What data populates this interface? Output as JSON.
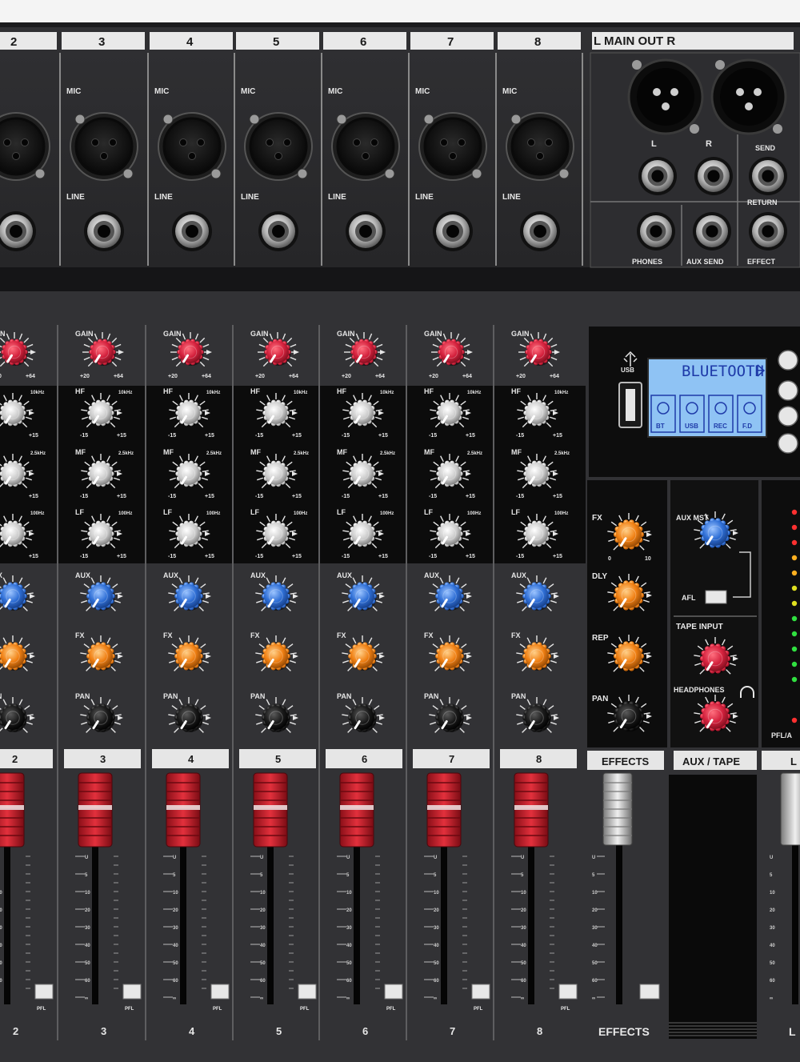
{
  "top_panel": {
    "channel_numbers": [
      "2",
      "3",
      "4",
      "5",
      "6",
      "7",
      "8"
    ],
    "mic_label": "MIC",
    "line_label": "LINE",
    "main_out_label": "L  MAIN OUT  R",
    "main_l": "L",
    "main_r": "R",
    "send_label": "SEND",
    "return_label": "RETURN",
    "phones_label": "PHONES",
    "aux_send_label": "AUX SEND",
    "effect_label": "EFFECT"
  },
  "channel_labels": {
    "gain": "GAIN",
    "hf": "HF",
    "mf": "MF",
    "lf": "LF",
    "aux": "AUX",
    "fx": "FX",
    "pan": "PAN",
    "gain_min": "+20",
    "gain_max": "+64",
    "hf_freq": "10kHz",
    "mf_freq": "2.5kHz",
    "lf_freq": "100Hz",
    "eq_min": "-15",
    "eq_max": "+15",
    "knob_min": "0",
    "knob_max": "10",
    "pfl": "PFL"
  },
  "strip_numbers": [
    "2",
    "3",
    "4",
    "5",
    "6",
    "7",
    "8"
  ],
  "fader_scale": [
    "U",
    "5",
    "10",
    "20",
    "30",
    "40",
    "50",
    "60",
    "∞"
  ],
  "display": {
    "usb_label": "USB",
    "lcd_text": "BLUETOOTH",
    "lcd_modes": [
      "BT",
      "USB",
      "REC",
      "F.D"
    ]
  },
  "master": {
    "fx_label": "FX",
    "dly_label": "DLY",
    "rep_label": "REP",
    "pan_label": "PAN",
    "aux_mst_label": "AUX\nMST",
    "afl_label": "AFL",
    "tape_input_label": "TAPE INPUT",
    "headphones_label": "HEADPHONES",
    "effects_header": "EFFECTS",
    "aux_tape_header": "AUX / TAPE",
    "effects_bottom": "EFFECTS",
    "main_l_header": "L",
    "pfl_afl": "PFL/A",
    "bottom_l": "L"
  },
  "colors": {
    "panel": "#2a2a2c",
    "chassis": "#3a3a3d",
    "eq_block": "#0c0c0c",
    "gain_knob": "#d4213d",
    "eq_knob": "#d0d0d0",
    "aux_knob": "#2f6fd6",
    "fx_knob": "#f07f12",
    "pan_knob": "#141414",
    "fader_cap": "#c8202c",
    "lcd": "#8fc3f4"
  },
  "icons": {
    "usb": "usb-port-icon",
    "headphones": "headphones-icon",
    "bluetooth": "bluetooth-icon"
  }
}
